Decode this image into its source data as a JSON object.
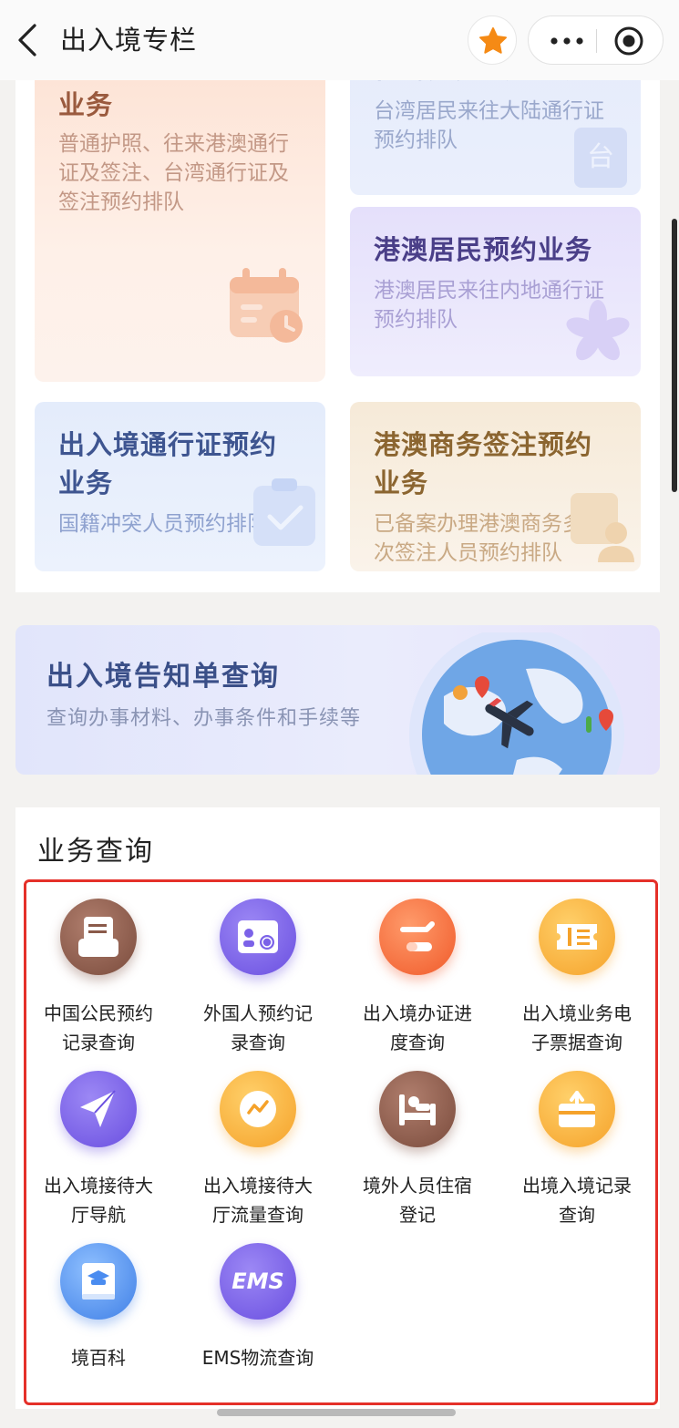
{
  "header": {
    "title": "出入境专栏"
  },
  "appointments": [
    {
      "title_line": "业务",
      "sub": [
        "普通护照、往来港澳通行",
        "证及签注、台湾通行证及",
        "签注预约排队"
      ],
      "icon": "calendar-icon"
    },
    {
      "title_clipped": "台湾居民预约业务",
      "sub": [
        "台湾居民来往大陆通行证",
        "预约排队"
      ],
      "icon": "tai-character-icon"
    },
    {
      "title": "港澳居民预约业务",
      "sub": [
        "港澳居民来往内地通行证",
        "预约排队"
      ],
      "icon": "bauhinia-icon"
    },
    {
      "title": [
        "出入境通行证预约",
        "业务"
      ],
      "sub": [
        "国籍冲突人员预约排队"
      ],
      "icon": "clipboard-check-icon"
    },
    {
      "title": [
        "港澳商务签注预约",
        "业务"
      ],
      "sub": [
        "已备案办理港澳商务多",
        "次签注人员预约排队"
      ],
      "icon": "business-person-icon"
    }
  ],
  "banner": {
    "title": "出入境告知单查询",
    "sub": "查询办事材料、办事条件和手续等"
  },
  "query": {
    "title": "业务查询",
    "items": [
      {
        "lines": [
          "中国公民预约",
          "记录查询"
        ],
        "icon": "inbox-doc-icon",
        "color": "#8a5a4a"
      },
      {
        "lines": [
          "外国人预约记",
          "录查询"
        ],
        "icon": "id-card-globe-icon",
        "color": "#7b62e8"
      },
      {
        "lines": [
          "出入境办证进",
          "度查询"
        ],
        "icon": "plane-progress-icon",
        "color": "#f4683a"
      },
      {
        "lines": [
          "出入境业务电",
          "子票据查询"
        ],
        "icon": "ticket-icon",
        "color": "#f7b23a"
      },
      {
        "lines": [
          "出入境接待大",
          "厅导航"
        ],
        "icon": "navigation-arrow-icon",
        "color": "#7b62e8"
      },
      {
        "lines": [
          "出入境接待大",
          "厅流量查询"
        ],
        "icon": "traffic-chart-icon",
        "color": "#f7b23a"
      },
      {
        "lines": [
          "境外人员住宿",
          "登记"
        ],
        "icon": "bed-icon",
        "color": "#8a5a4a"
      },
      {
        "lines": [
          "出境入境记录",
          "查询"
        ],
        "icon": "record-upload-icon",
        "color": "#f7b23a"
      },
      {
        "lines": [
          "境百科"
        ],
        "icon": "book-graduation-icon",
        "color": "#4a8cf0"
      },
      {
        "lines": [
          "EMS物流查询"
        ],
        "icon": "ems-logo-icon",
        "color": "#7b62e8",
        "logo_text": "EMS"
      }
    ]
  }
}
